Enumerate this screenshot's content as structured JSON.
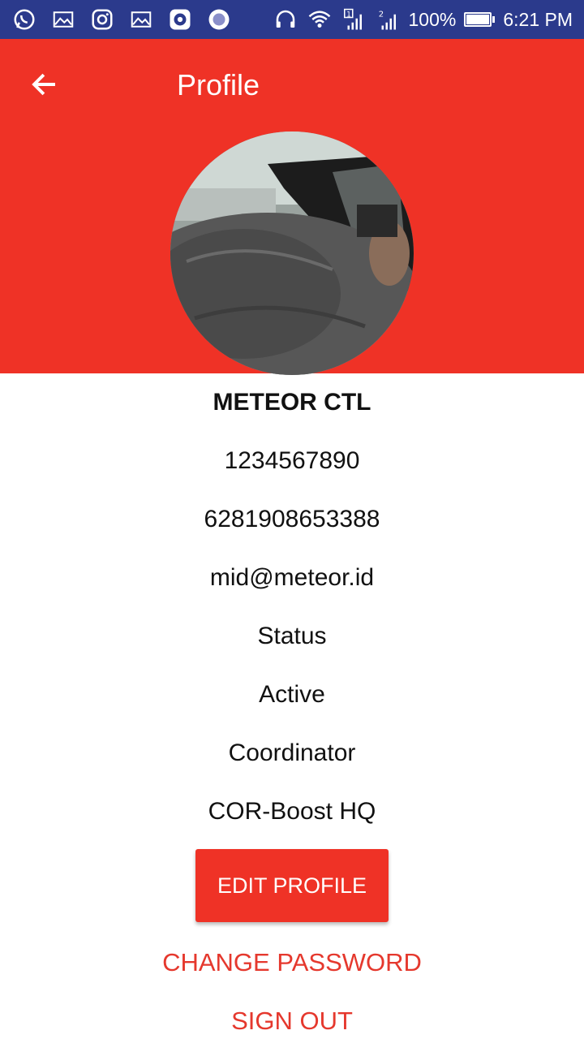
{
  "status_bar": {
    "battery": "100%",
    "time": "6:21 PM",
    "sim1": "1",
    "sim2": "2",
    "icons": [
      "whatsapp-icon",
      "gallery-icon",
      "instagram-icon",
      "gallery-icon",
      "music-icon",
      "record-icon",
      "headset-icon",
      "wifi-icon",
      "signal-icon",
      "signal-icon"
    ]
  },
  "header": {
    "title": "Profile",
    "color": "#ef3226"
  },
  "profile": {
    "name": "METEOR CTL",
    "id": "1234567890",
    "phone": "6281908653388",
    "email": "mid@meteor.id",
    "status_label": "Status",
    "status_value": "Active",
    "role": "Coordinator",
    "office": "COR-Boost HQ"
  },
  "actions": {
    "edit_profile": "EDIT PROFILE",
    "change_password": "CHANGE PASSWORD",
    "sign_out": "SIGN OUT"
  }
}
